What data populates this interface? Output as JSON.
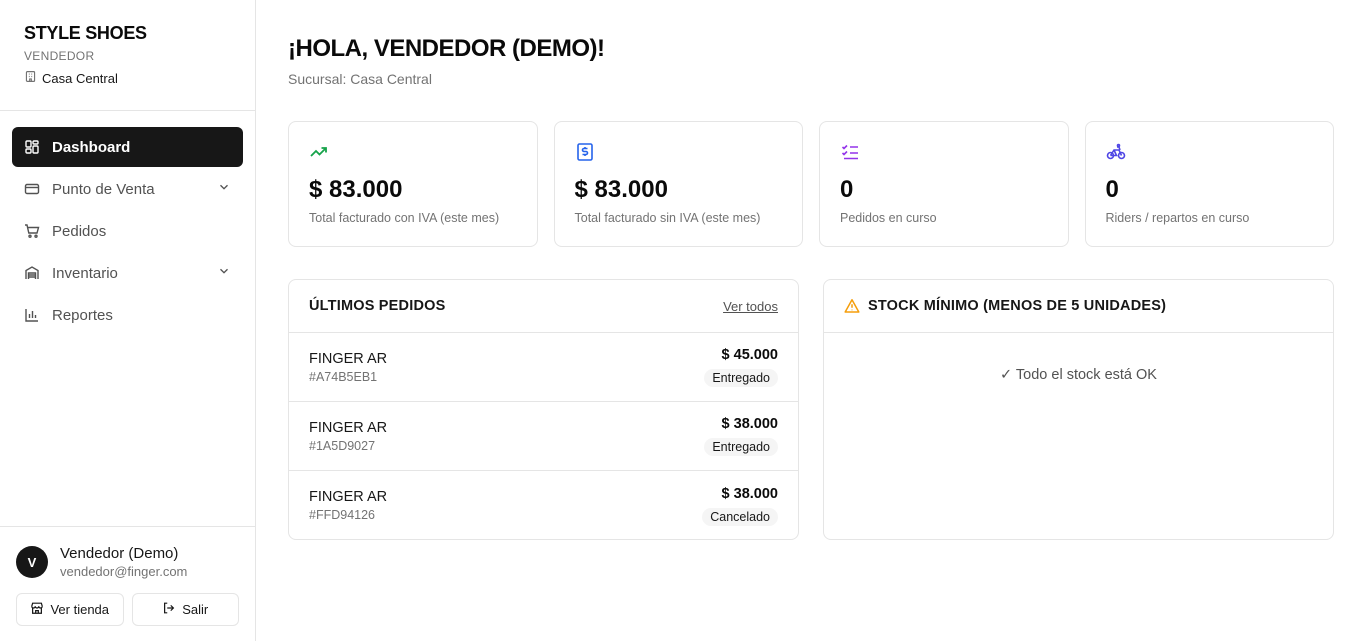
{
  "brand": {
    "title": "STYLE SHOES",
    "role": "VENDEDOR",
    "branch": "Casa Central",
    "branch_icon": "building-icon"
  },
  "nav": {
    "items": [
      {
        "label": "Dashboard",
        "icon": "dashboard-icon",
        "active": true
      },
      {
        "label": "Punto de Venta",
        "icon": "credit-card-icon",
        "expandable": true
      },
      {
        "label": "Pedidos",
        "icon": "cart-icon"
      },
      {
        "label": "Inventario",
        "icon": "warehouse-icon",
        "expandable": true
      },
      {
        "label": "Reportes",
        "icon": "bar-chart-icon"
      }
    ]
  },
  "user": {
    "initial": "V",
    "name": "Vendedor (Demo)",
    "email": "vendedor@finger.com",
    "store_button": "Ver tienda",
    "logout_button": "Salir"
  },
  "header": {
    "greeting": "¡HOLA, VENDEDOR (DEMO)!",
    "branch_line": "Sucursal: Casa Central"
  },
  "stats": [
    {
      "value": "$ 83.000",
      "label": "Total facturado con IVA (este mes)",
      "icon": "trending-up-icon",
      "color": "#16a34a"
    },
    {
      "value": "$ 83.000",
      "label": "Total facturado sin IVA (este mes)",
      "icon": "receipt-dollar-icon",
      "color": "#2563eb"
    },
    {
      "value": "0",
      "label": "Pedidos en curso",
      "icon": "checklist-icon",
      "color": "#9333ea"
    },
    {
      "value": "0",
      "label": "Riders / repartos en curso",
      "icon": "bike-icon",
      "color": "#4f46e5"
    }
  ],
  "orders": {
    "title": "ÚLTIMOS PEDIDOS",
    "view_all": "Ver todos",
    "rows": [
      {
        "name": "FINGER AR",
        "id": "#A74B5EB1",
        "amount": "$ 45.000",
        "status": "Entregado"
      },
      {
        "name": "FINGER AR",
        "id": "#1A5D9027",
        "amount": "$ 38.000",
        "status": "Entregado"
      },
      {
        "name": "FINGER AR",
        "id": "#FFD94126",
        "amount": "$ 38.000",
        "status": "Cancelado"
      }
    ]
  },
  "stock": {
    "title": "STOCK MÍNIMO (MENOS DE 5 UNIDADES)",
    "warn_color": "#f59e0b",
    "ok_message": "✓ Todo el stock está OK"
  },
  "colors": {
    "active_nav_bg": "#171717",
    "border": "#e5e5e5",
    "muted_text": "#737373"
  }
}
